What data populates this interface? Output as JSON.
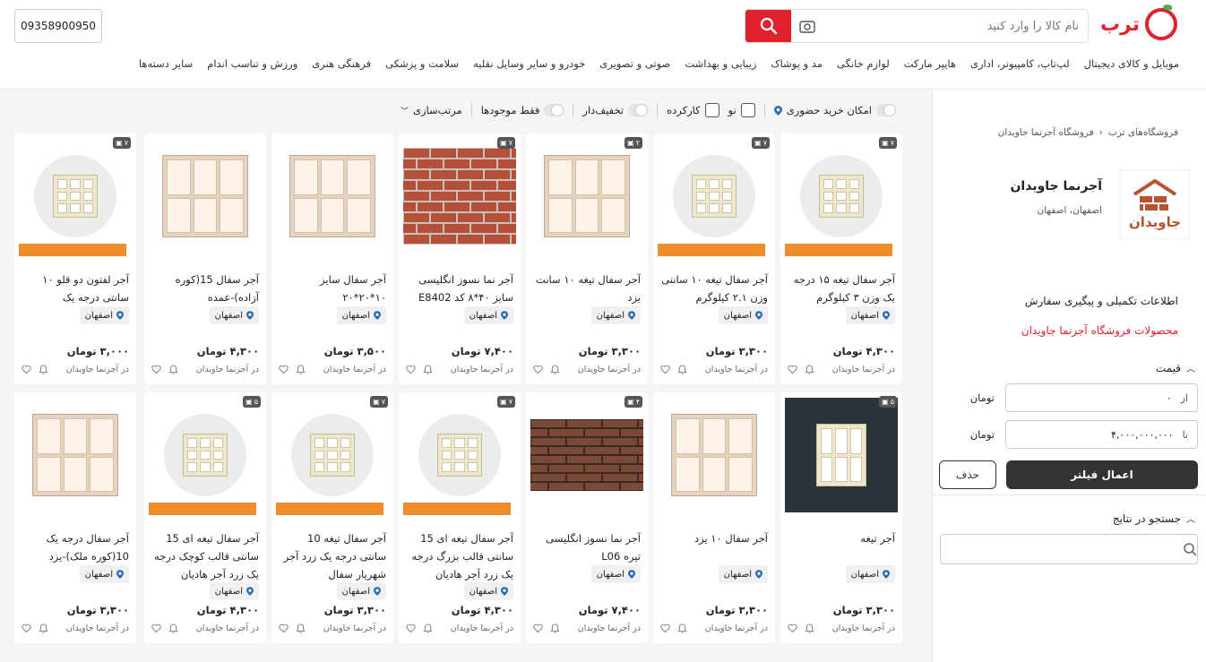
{
  "header": {
    "logo_text": "ترب",
    "search_placeholder": "نام کالا را وارد کنید",
    "phone": "09358900950",
    "colors": {
      "brand": "#e0222f",
      "dark": "#333333"
    }
  },
  "nav": [
    "موبایل و کالای دیجیتال",
    "لپ‌تاپ، کامپیوتر، اداری",
    "هایپر مارکت",
    "لوازم خانگی",
    "مد و پوشاک",
    "زیبایی و بهداشت",
    "صوتی و تصویری",
    "خودرو و سایر وسایل نقلیه",
    "سلامت و پزشکی",
    "فرهنگی هنری",
    "ورزش و تناسب اندام",
    "سایر دسته‌ها"
  ],
  "filters": {
    "in_person": "امکان خرید حضوری",
    "new": "نو",
    "used": "کارکرده",
    "discount": "تخفیف‌دار",
    "in_stock": "فقط موجودها",
    "sort": "مرتب‌سازی"
  },
  "sidebar": {
    "breadcrumb_root": "فروشگاه‌های ترب",
    "breadcrumb_current": "فروشگاه آجرنما جاویدان",
    "store_name": "آجرنما جاویدان",
    "store_location": "اصفهان، اصفهان",
    "logo_text": "جاویدان",
    "info_link": "اطلاعات تکمیلی و پیگیری سفارش",
    "products_link": "محصولات فروشگاه آجرنما جاویدان",
    "price_title": "قیمت",
    "from_label": "از",
    "from_value": "۰",
    "to_label": "تا",
    "to_value": "۴,۰۰۰,۰۰۰,۰۰۰",
    "unit": "تومان",
    "apply": "اعمال فیلتر",
    "delete": "حذف",
    "search_results": "جستجو در نتایج"
  },
  "products": [
    {
      "title": "آجر سفال تیغه ۱۵ درجه یک وزن ۳ کیلوگرم",
      "city": "اصفهان",
      "price": "۴,۳۰۰ تومان",
      "seller": "در آجرنما جاویدان",
      "images": "۷",
      "kind": "circle"
    },
    {
      "title": "آجر سفال تیغه ۱۰ سانتی وزن ۲.۱ کیلوگرم",
      "city": "اصفهان",
      "price": "۳,۳۰۰ تومان",
      "seller": "در آجرنما جاویدان",
      "images": "۷",
      "kind": "circle"
    },
    {
      "title": "آجر سفال تیغه ۱۰ سانت یزد",
      "city": "اصفهان",
      "price": "۳,۳۰۰ تومان",
      "seller": "در آجرنما جاویدان",
      "images": "۲",
      "kind": "block"
    },
    {
      "title": "آجر نما نسوز انگلیسی سایز ۴۰*۸ کد E8402",
      "city": "اصفهان",
      "price": "۷,۴۰۰ تومان",
      "seller": "در آجرنما جاویدان",
      "images": "۷",
      "kind": "wall"
    },
    {
      "title": "آجر سفال سایز ۱۰*۲۰*۲۰",
      "city": "اصفهان",
      "price": "۳,۵۰۰ تومان",
      "seller": "در آجرنما جاویدان",
      "images": "",
      "kind": "block"
    },
    {
      "title": "آجر سفال 15(کوره آزاده)-عمده",
      "city": "اصفهان",
      "price": "۴,۳۰۰ تومان",
      "seller": "در آجرنما جاویدان",
      "images": "",
      "kind": "block"
    },
    {
      "title": "آجر لفتون دو قلو ۱۰ سانتی درجه یک",
      "city": "اصفهان",
      "price": "۳,۰۰۰ تومان",
      "seller": "در آجرنما جاویدان",
      "images": "۷",
      "kind": "circle"
    },
    {
      "title": "آجر تیغه",
      "city": "اصفهان",
      "price": "۳,۳۰۰ تومان",
      "seller": "در آجرنما جاویدان",
      "images": "۵",
      "kind": "photo"
    },
    {
      "title": "آجر سفال ۱۰ یزد",
      "city": "اصفهان",
      "price": "۳,۳۰۰ تومان",
      "seller": "در آجرنما جاویدان",
      "images": "",
      "kind": "block"
    },
    {
      "title": "آجر نما نسوز انگلیسی تیره L06",
      "city": "اصفهان",
      "price": "۷,۴۰۰ تومان",
      "seller": "در آجرنما جاویدان",
      "images": "۴",
      "kind": "dark"
    },
    {
      "title": "آجر سفال تیغه ای 15 سانتی قالب بزرگ درجه یک زرد آجر هادیان",
      "city": "اصفهان",
      "price": "۴,۳۰۰ تومان",
      "seller": "در آجرنما جاویدان",
      "images": "۷",
      "kind": "circle"
    },
    {
      "title": "آجر سفال تیغه 10 سانتی درجه یک زرد آجر شهریار سفال",
      "city": "اصفهان",
      "price": "۳,۳۰۰ تومان",
      "seller": "در آجرنما جاویدان",
      "images": "۷",
      "kind": "circle"
    },
    {
      "title": "آجر سفال تیغه ای 15 سانتی قالب کوچک درجه یک زرد آجر هادیان",
      "city": "اصفهان",
      "price": "۴,۳۰۰ تومان",
      "seller": "در آجرنما جاویدان",
      "images": "۵",
      "kind": "circle"
    },
    {
      "title": "آجر سفال درجه یک 10(کوره ملک)-یزد",
      "city": "اصفهان",
      "price": "۳,۳۰۰ تومان",
      "seller": "در آجرنما جاویدان",
      "images": "",
      "kind": "block"
    }
  ]
}
